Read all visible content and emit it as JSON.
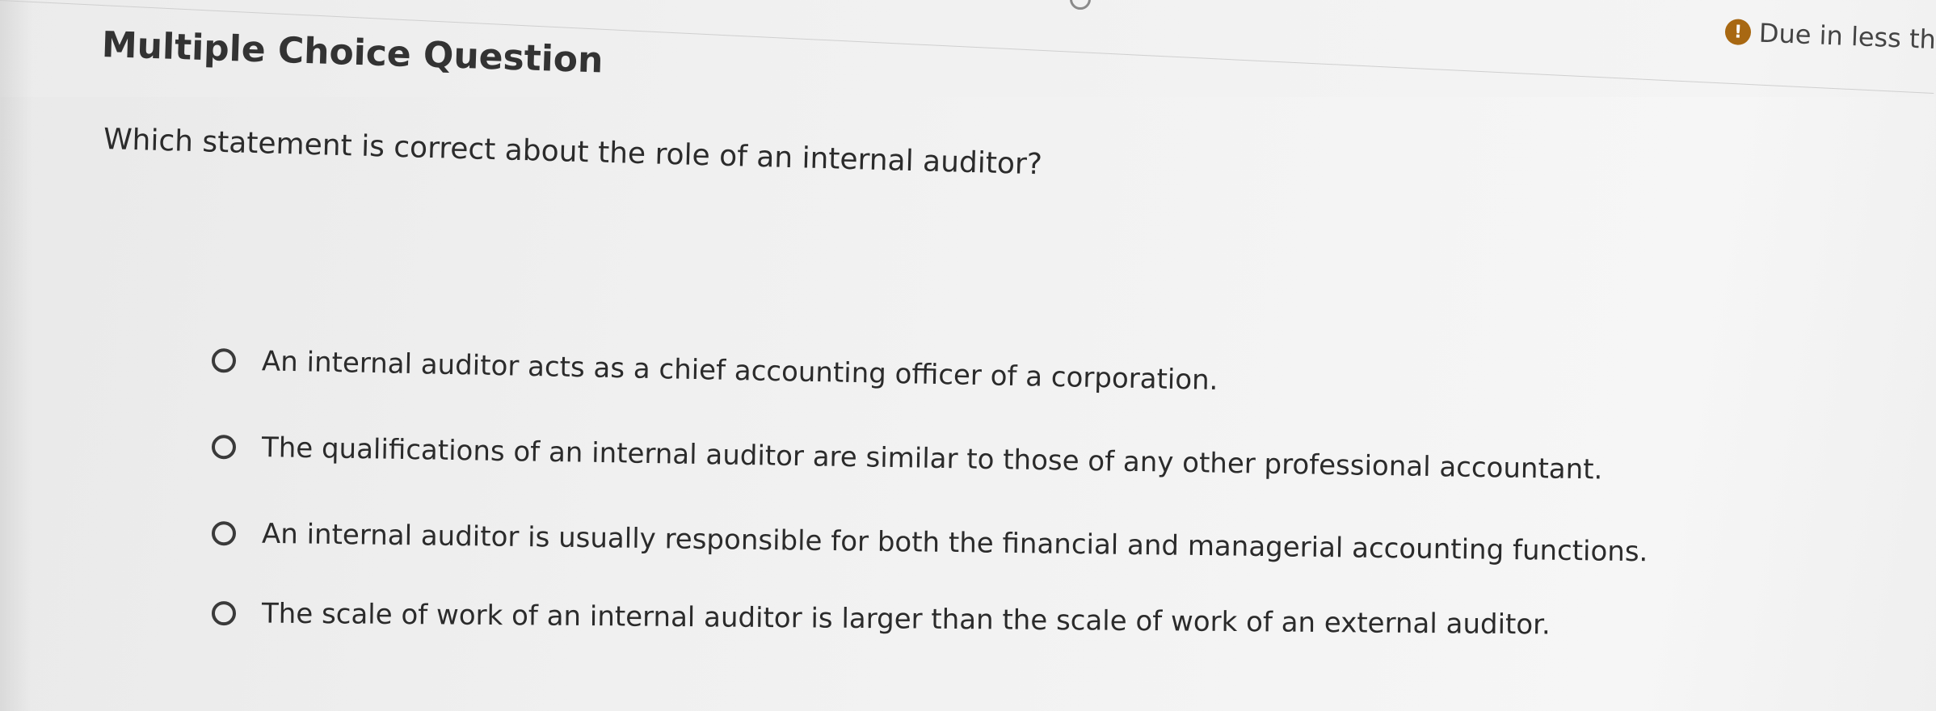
{
  "header": {
    "title": "Multiple Choice Question",
    "due_text": "Due in less than",
    "due_icon": "clock-alert-icon",
    "due_icon_glyph": "!",
    "due_icon_color": "#a86812"
  },
  "question": {
    "text": "Which statement is correct about the role of an internal auditor?",
    "options": [
      {
        "label": "An internal auditor acts as a chief accounting officer of a corporation.",
        "selected": false
      },
      {
        "label": "The qualifications of an internal auditor are similar to those of any other professional accountant.",
        "selected": false
      },
      {
        "label": "An internal auditor is usually responsible for both the financial and managerial accounting functions.",
        "selected": false
      },
      {
        "label": "The scale of work of an internal auditor is larger than the scale of work of an external auditor.",
        "selected": false
      }
    ]
  }
}
